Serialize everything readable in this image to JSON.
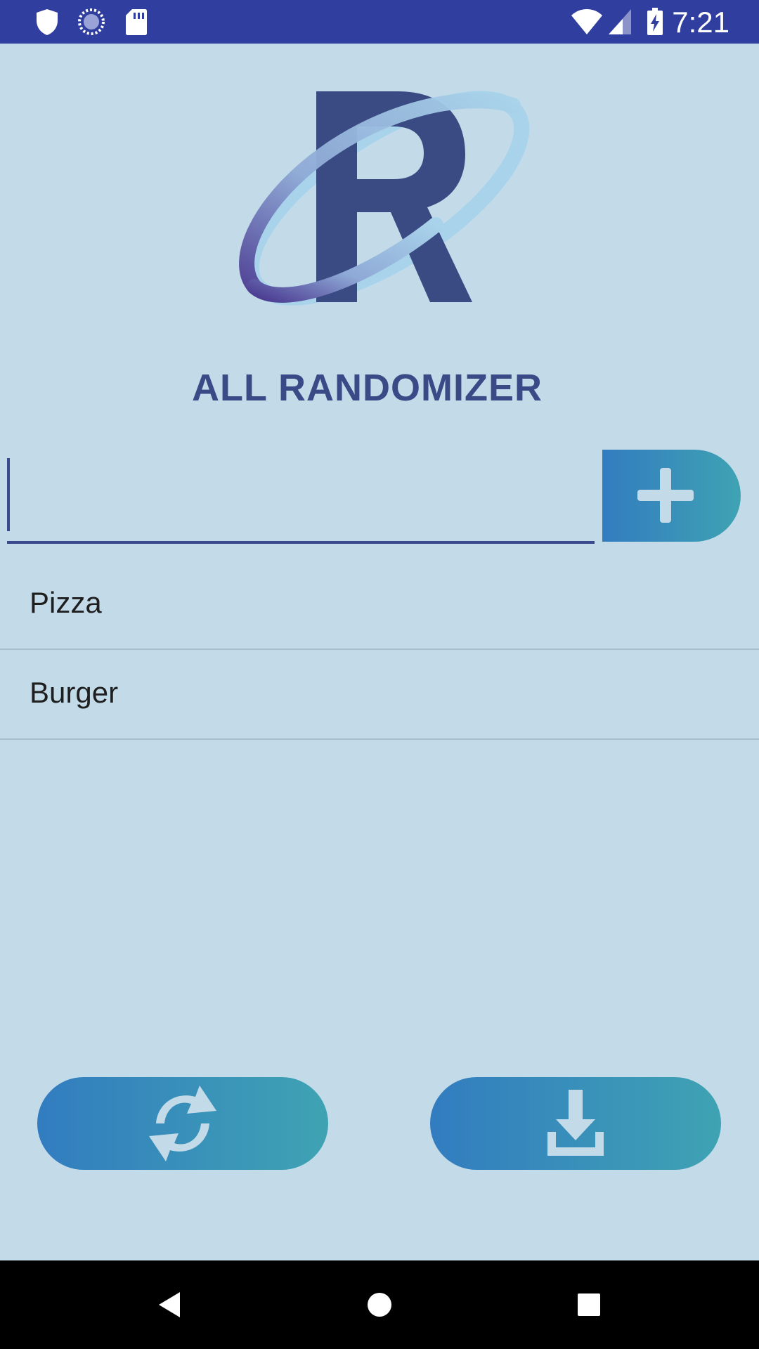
{
  "status_bar": {
    "time": "7:21",
    "icons": [
      "shield-icon",
      "sync-icon",
      "sd-card-icon",
      "wifi-icon",
      "cell-signal-icon",
      "battery-charging-icon"
    ]
  },
  "app": {
    "title": "ALL RANDOMIZER",
    "logo": "r-orbit-logo"
  },
  "input": {
    "value": "",
    "placeholder": ""
  },
  "add_button": {
    "icon": "plus-icon"
  },
  "items": [
    {
      "label": "Pizza"
    },
    {
      "label": "Burger"
    }
  ],
  "actions": {
    "shuffle_icon": "shuffle-icon",
    "download_icon": "download-icon"
  },
  "nav": [
    "back-icon",
    "home-icon",
    "recents-icon"
  ],
  "colors": {
    "status_bar": "#303f9f",
    "background": "#c3dbe8",
    "title": "#394a86",
    "button_gradient_start": "#327cc0",
    "button_gradient_end": "#3fa3b3"
  }
}
